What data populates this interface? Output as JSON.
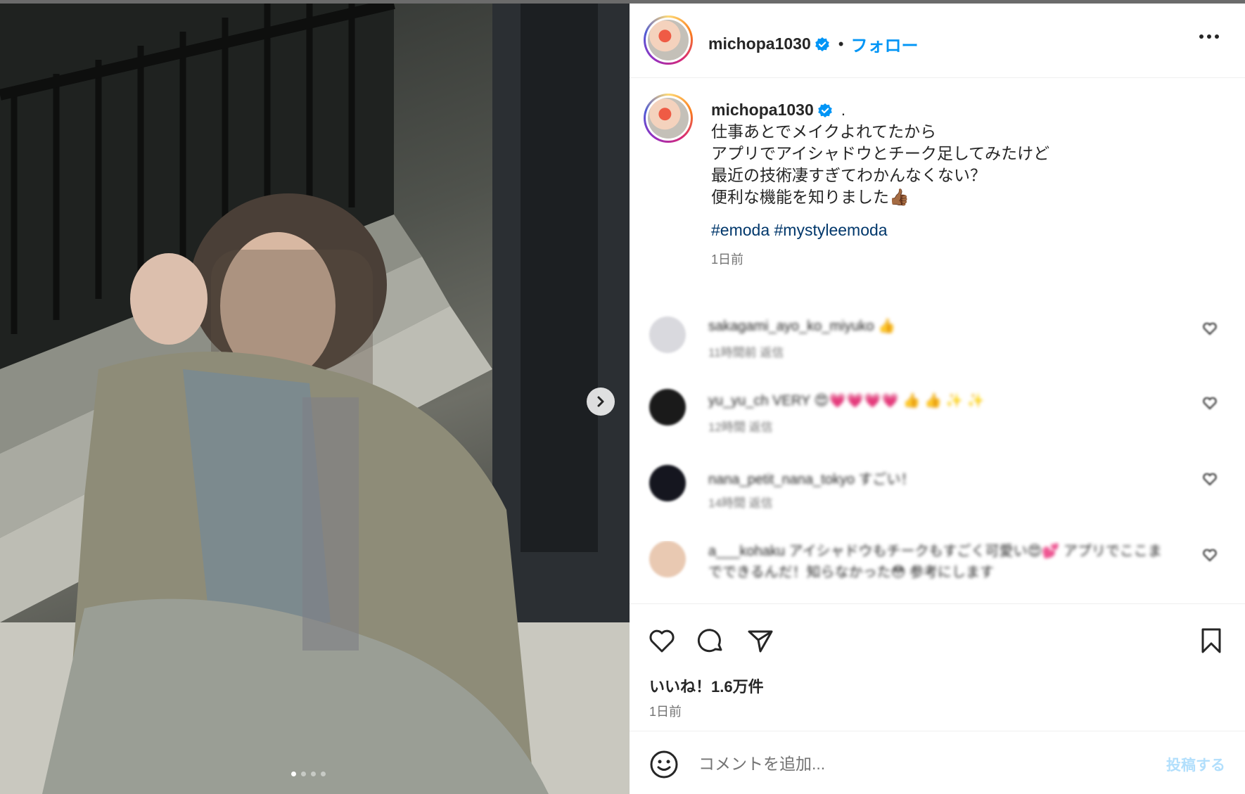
{
  "post": {
    "username": "michopa1030",
    "separator": "•",
    "follow_label": "フォロー",
    "more_icon": "more-horizontal-icon"
  },
  "caption": {
    "username": "michopa1030",
    "dot": ".",
    "text": "仕事あとでメイクよれてたから\nアプリでアイシャドウとチーク足してみたけど\n最近の技術凄すぎてわかんなくない？\n便利な機能を知りました👍🏾",
    "hashtags": [
      "#emoda",
      "#mystyleemoda"
    ],
    "time": "1日前"
  },
  "comments": [
    {
      "text": "sakagami_ayo_ko_miyuko 👍",
      "meta": "11時間前   返信",
      "avatar_color": "#d9d9de"
    },
    {
      "text": "yu_yu_ch VERY 😍💗💗💗💗 👍 👍 ✨ ✨",
      "meta": "12時間   返信",
      "avatar_color": "#1a1a1a"
    },
    {
      "text": "nana_petit_nana_tokyo すごい！",
      "meta": "14時間   返信",
      "avatar_color": "#15161f"
    },
    {
      "text": "a___kohaku アイシャドウもチークもすごく可愛い😍💕 アプリでここまでできるんだ！知らなかった😳 参考にします",
      "meta": "",
      "avatar_color": "#e9c9b2"
    }
  ],
  "actions": {
    "like_icon": "heart-icon",
    "comment_icon": "comment-icon",
    "share_icon": "send-icon",
    "save_icon": "bookmark-icon",
    "likes_label": "いいね！1.6万件",
    "time": "1日前"
  },
  "add_comment": {
    "emoji_icon": "emoji-icon",
    "placeholder": "コメントを追加...",
    "post_label": "投稿する"
  },
  "carousel": {
    "total_slides": 4,
    "current_slide": 1,
    "next_icon": "chevron-right-icon"
  },
  "colors": {
    "accent": "#0095f6",
    "hashtag": "#00376b",
    "muted": "#737373",
    "post_disabled": "#b2dffc"
  }
}
